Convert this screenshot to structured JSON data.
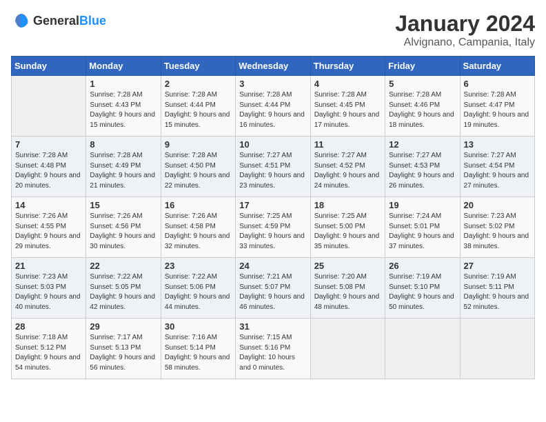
{
  "logo": {
    "general": "General",
    "blue": "Blue"
  },
  "title": {
    "month_year": "January 2024",
    "location": "Alvignano, Campania, Italy"
  },
  "headers": [
    "Sunday",
    "Monday",
    "Tuesday",
    "Wednesday",
    "Thursday",
    "Friday",
    "Saturday"
  ],
  "weeks": [
    [
      {
        "num": "",
        "sunrise": "",
        "sunset": "",
        "daylight": ""
      },
      {
        "num": "1",
        "sunrise": "Sunrise: 7:28 AM",
        "sunset": "Sunset: 4:43 PM",
        "daylight": "Daylight: 9 hours and 15 minutes."
      },
      {
        "num": "2",
        "sunrise": "Sunrise: 7:28 AM",
        "sunset": "Sunset: 4:44 PM",
        "daylight": "Daylight: 9 hours and 15 minutes."
      },
      {
        "num": "3",
        "sunrise": "Sunrise: 7:28 AM",
        "sunset": "Sunset: 4:44 PM",
        "daylight": "Daylight: 9 hours and 16 minutes."
      },
      {
        "num": "4",
        "sunrise": "Sunrise: 7:28 AM",
        "sunset": "Sunset: 4:45 PM",
        "daylight": "Daylight: 9 hours and 17 minutes."
      },
      {
        "num": "5",
        "sunrise": "Sunrise: 7:28 AM",
        "sunset": "Sunset: 4:46 PM",
        "daylight": "Daylight: 9 hours and 18 minutes."
      },
      {
        "num": "6",
        "sunrise": "Sunrise: 7:28 AM",
        "sunset": "Sunset: 4:47 PM",
        "daylight": "Daylight: 9 hours and 19 minutes."
      }
    ],
    [
      {
        "num": "7",
        "sunrise": "Sunrise: 7:28 AM",
        "sunset": "Sunset: 4:48 PM",
        "daylight": "Daylight: 9 hours and 20 minutes."
      },
      {
        "num": "8",
        "sunrise": "Sunrise: 7:28 AM",
        "sunset": "Sunset: 4:49 PM",
        "daylight": "Daylight: 9 hours and 21 minutes."
      },
      {
        "num": "9",
        "sunrise": "Sunrise: 7:28 AM",
        "sunset": "Sunset: 4:50 PM",
        "daylight": "Daylight: 9 hours and 22 minutes."
      },
      {
        "num": "10",
        "sunrise": "Sunrise: 7:27 AM",
        "sunset": "Sunset: 4:51 PM",
        "daylight": "Daylight: 9 hours and 23 minutes."
      },
      {
        "num": "11",
        "sunrise": "Sunrise: 7:27 AM",
        "sunset": "Sunset: 4:52 PM",
        "daylight": "Daylight: 9 hours and 24 minutes."
      },
      {
        "num": "12",
        "sunrise": "Sunrise: 7:27 AM",
        "sunset": "Sunset: 4:53 PM",
        "daylight": "Daylight: 9 hours and 26 minutes."
      },
      {
        "num": "13",
        "sunrise": "Sunrise: 7:27 AM",
        "sunset": "Sunset: 4:54 PM",
        "daylight": "Daylight: 9 hours and 27 minutes."
      }
    ],
    [
      {
        "num": "14",
        "sunrise": "Sunrise: 7:26 AM",
        "sunset": "Sunset: 4:55 PM",
        "daylight": "Daylight: 9 hours and 29 minutes."
      },
      {
        "num": "15",
        "sunrise": "Sunrise: 7:26 AM",
        "sunset": "Sunset: 4:56 PM",
        "daylight": "Daylight: 9 hours and 30 minutes."
      },
      {
        "num": "16",
        "sunrise": "Sunrise: 7:26 AM",
        "sunset": "Sunset: 4:58 PM",
        "daylight": "Daylight: 9 hours and 32 minutes."
      },
      {
        "num": "17",
        "sunrise": "Sunrise: 7:25 AM",
        "sunset": "Sunset: 4:59 PM",
        "daylight": "Daylight: 9 hours and 33 minutes."
      },
      {
        "num": "18",
        "sunrise": "Sunrise: 7:25 AM",
        "sunset": "Sunset: 5:00 PM",
        "daylight": "Daylight: 9 hours and 35 minutes."
      },
      {
        "num": "19",
        "sunrise": "Sunrise: 7:24 AM",
        "sunset": "Sunset: 5:01 PM",
        "daylight": "Daylight: 9 hours and 37 minutes."
      },
      {
        "num": "20",
        "sunrise": "Sunrise: 7:23 AM",
        "sunset": "Sunset: 5:02 PM",
        "daylight": "Daylight: 9 hours and 38 minutes."
      }
    ],
    [
      {
        "num": "21",
        "sunrise": "Sunrise: 7:23 AM",
        "sunset": "Sunset: 5:03 PM",
        "daylight": "Daylight: 9 hours and 40 minutes."
      },
      {
        "num": "22",
        "sunrise": "Sunrise: 7:22 AM",
        "sunset": "Sunset: 5:05 PM",
        "daylight": "Daylight: 9 hours and 42 minutes."
      },
      {
        "num": "23",
        "sunrise": "Sunrise: 7:22 AM",
        "sunset": "Sunset: 5:06 PM",
        "daylight": "Daylight: 9 hours and 44 minutes."
      },
      {
        "num": "24",
        "sunrise": "Sunrise: 7:21 AM",
        "sunset": "Sunset: 5:07 PM",
        "daylight": "Daylight: 9 hours and 46 minutes."
      },
      {
        "num": "25",
        "sunrise": "Sunrise: 7:20 AM",
        "sunset": "Sunset: 5:08 PM",
        "daylight": "Daylight: 9 hours and 48 minutes."
      },
      {
        "num": "26",
        "sunrise": "Sunrise: 7:19 AM",
        "sunset": "Sunset: 5:10 PM",
        "daylight": "Daylight: 9 hours and 50 minutes."
      },
      {
        "num": "27",
        "sunrise": "Sunrise: 7:19 AM",
        "sunset": "Sunset: 5:11 PM",
        "daylight": "Daylight: 9 hours and 52 minutes."
      }
    ],
    [
      {
        "num": "28",
        "sunrise": "Sunrise: 7:18 AM",
        "sunset": "Sunset: 5:12 PM",
        "daylight": "Daylight: 9 hours and 54 minutes."
      },
      {
        "num": "29",
        "sunrise": "Sunrise: 7:17 AM",
        "sunset": "Sunset: 5:13 PM",
        "daylight": "Daylight: 9 hours and 56 minutes."
      },
      {
        "num": "30",
        "sunrise": "Sunrise: 7:16 AM",
        "sunset": "Sunset: 5:14 PM",
        "daylight": "Daylight: 9 hours and 58 minutes."
      },
      {
        "num": "31",
        "sunrise": "Sunrise: 7:15 AM",
        "sunset": "Sunset: 5:16 PM",
        "daylight": "Daylight: 10 hours and 0 minutes."
      },
      {
        "num": "",
        "sunrise": "",
        "sunset": "",
        "daylight": ""
      },
      {
        "num": "",
        "sunrise": "",
        "sunset": "",
        "daylight": ""
      },
      {
        "num": "",
        "sunrise": "",
        "sunset": "",
        "daylight": ""
      }
    ]
  ]
}
